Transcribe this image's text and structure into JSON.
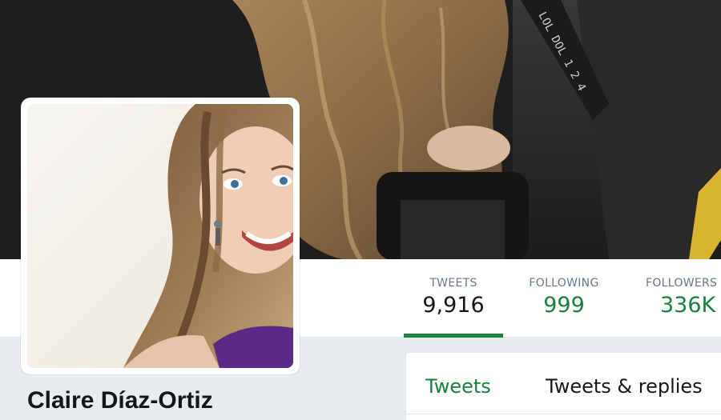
{
  "profile": {
    "name": "Claire Díaz-Ortiz"
  },
  "stats": [
    {
      "label": "TWEETS",
      "value": "9,916",
      "active": true
    },
    {
      "label": "FOLLOWING",
      "value": "999",
      "active": false
    },
    {
      "label": "FOLLOWERS",
      "value": "336K",
      "active": false
    }
  ],
  "tabs": [
    {
      "label": "Tweets",
      "active": true
    },
    {
      "label": "Tweets & replies",
      "active": false
    }
  ],
  "banner_text": "LOL DOL 1 2 4",
  "colors": {
    "accent": "#19803c",
    "text": "#14171a",
    "muted": "#657786",
    "background": "#e6ecf0"
  },
  "icons": {
    "avatar": "profile-photo",
    "banner": "header-photo"
  }
}
